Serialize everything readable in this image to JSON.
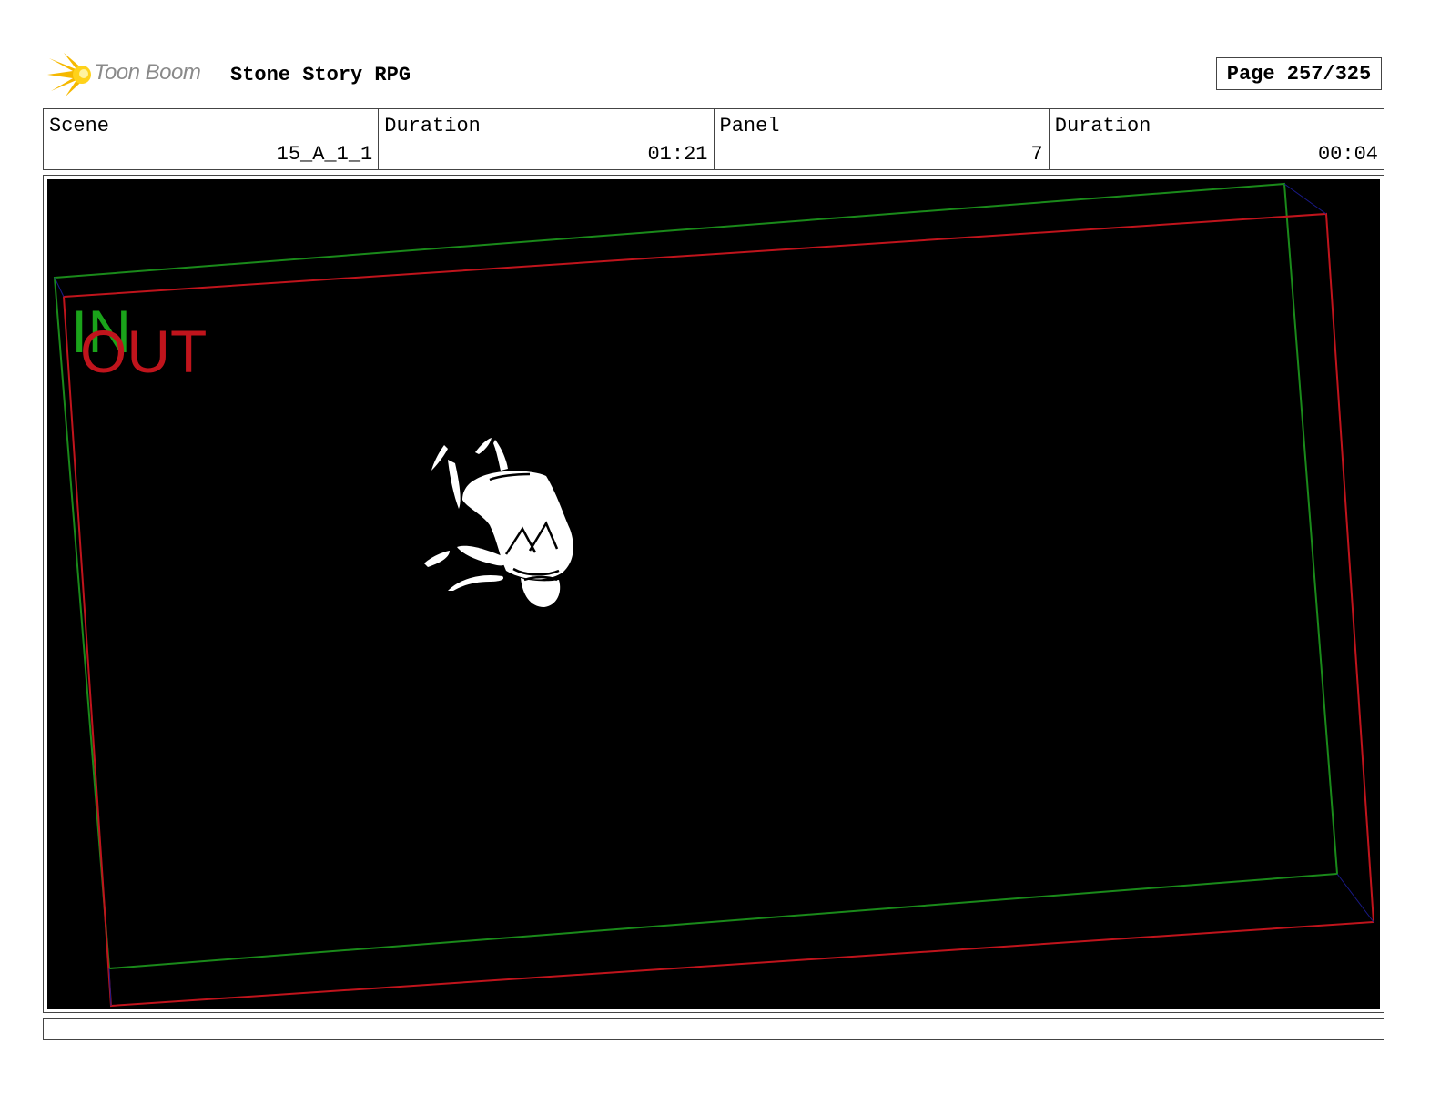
{
  "header": {
    "logo_text": "Toon Boom",
    "logo_icon": "toon-boom-star-logo",
    "project_title": "Stone Story RPG",
    "page_label": "Page 257/325"
  },
  "info": {
    "scene_label": "Scene",
    "scene_value": "15_A_1_1",
    "scene_duration_label": "Duration",
    "scene_duration_value": "01:21",
    "panel_label": "Panel",
    "panel_value": "7",
    "panel_duration_label": "Duration",
    "panel_duration_value": "00:04"
  },
  "panel": {
    "in_label": "IN",
    "out_label": "OUT",
    "in_color": "#1aa31a",
    "out_color": "#c0141c",
    "background": "#000000"
  },
  "caption": {
    "text": ""
  }
}
